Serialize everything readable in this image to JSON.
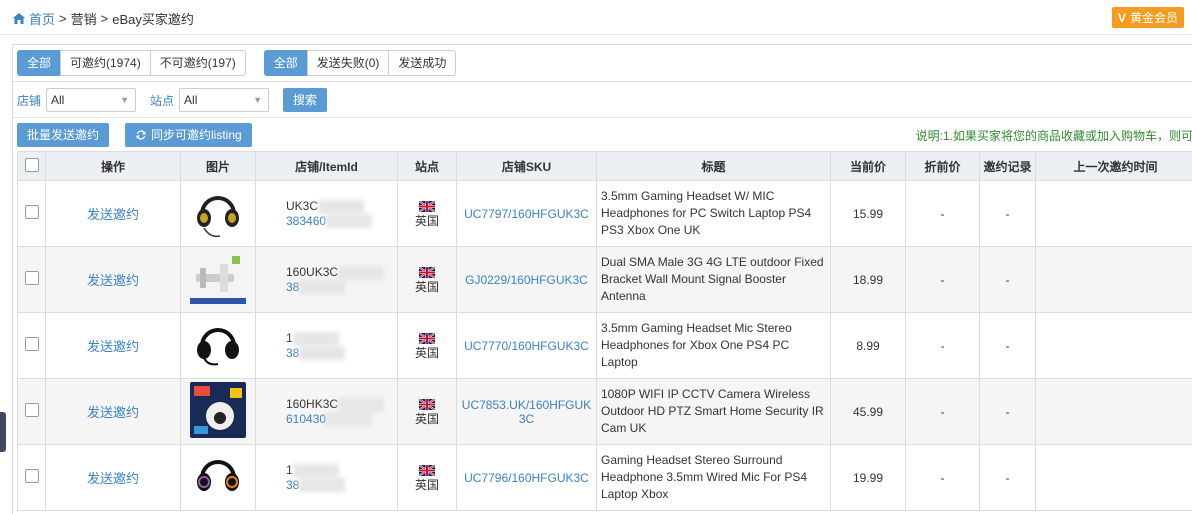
{
  "breadcrumb": {
    "home": "首页",
    "sep1": ">",
    "mid": "营销",
    "sep2": ">",
    "current": "eBay买家邀约"
  },
  "vip_label": "黄金会员",
  "filter_groups": {
    "invite": [
      {
        "label": "全部",
        "active": true
      },
      {
        "label": "可邀约(1974)",
        "active": false
      },
      {
        "label": "不可邀约(197)",
        "active": false
      }
    ],
    "send": [
      {
        "label": "全部",
        "active": true
      },
      {
        "label": "发送失败(0)",
        "active": false
      },
      {
        "label": "发送成功",
        "active": false
      }
    ]
  },
  "store_label": "店铺",
  "store_value": "All",
  "site_label": "站点",
  "site_value": "All",
  "search_label": "搜索",
  "batch_label": "批量发送邀约",
  "sync_label": "同步可邀约listing",
  "note": "说明:1.如果买家将您的商品收藏或加入购物车，则可",
  "columns": [
    "操作",
    "图片",
    "店铺/ItemId",
    "站点",
    "店铺SKU",
    "标题",
    "当前价",
    "折前价",
    "邀约记录",
    "上一次邀约时间"
  ],
  "rows": [
    {
      "action": "发送邀约",
      "id1": "UK3C",
      "id2": "383460",
      "site": "英国",
      "sku": "UC7797/160HFGUK3C",
      "title": "3.5mm Gaming Headset W/ MIC Headphones for PC Switch Laptop PS4 PS3 Xbox One UK",
      "price": "15.99",
      "orig": "-",
      "record": "-",
      "last": ""
    },
    {
      "action": "发送邀约",
      "id1": "160UK3C",
      "id2": "38",
      "site": "英国",
      "sku": "GJ0229/160HFGUK3C",
      "title": "Dual SMA Male 3G 4G LTE outdoor Fixed Bracket Wall Mount Signal Booster Antenna",
      "price": "18.99",
      "orig": "-",
      "record": "-",
      "last": ""
    },
    {
      "action": "发送邀约",
      "id1": "1",
      "id2": "38",
      "site": "英国",
      "sku": "UC7770/160HFGUK3C",
      "title": "3.5mm Gaming Headset Mic Stereo Headphones for Xbox One PS4 PC Laptop",
      "price": "8.99",
      "orig": "-",
      "record": "-",
      "last": ""
    },
    {
      "action": "发送邀约",
      "id1": "160HK3C",
      "id2": "610430",
      "site": "英国",
      "sku": "UC7853.UK/160HFGUK3C",
      "title": "1080P WIFI IP CCTV Camera Wireless Outdoor HD PTZ Smart Home Security IR Cam UK",
      "price": "45.99",
      "orig": "-",
      "record": "-",
      "last": ""
    },
    {
      "action": "发送邀约",
      "id1": "1",
      "id2": "38",
      "site": "英国",
      "sku": "UC7796/160HFGUK3C",
      "title": "Gaming Headset Stereo Surround Headphone 3.5mm Wired Mic For PS4 Laptop Xbox",
      "price": "19.99",
      "orig": "-",
      "record": "-",
      "last": ""
    }
  ]
}
